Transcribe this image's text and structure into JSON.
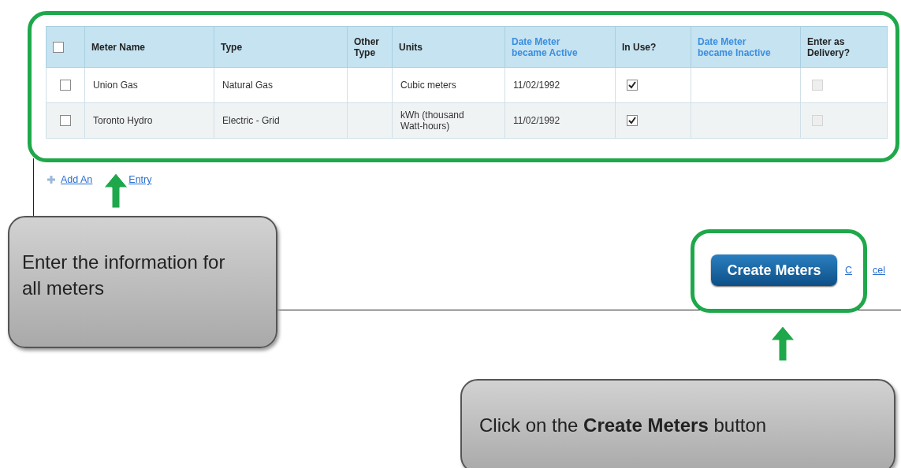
{
  "table": {
    "select_all": {
      "checked": false
    },
    "columns": [
      {
        "label": "Meter Name",
        "sortable": false
      },
      {
        "label": "Type",
        "sortable": false
      },
      {
        "label": "Other Type",
        "sortable": false
      },
      {
        "label": "Units",
        "sortable": false
      },
      {
        "label": "Date Meter became Active",
        "sortable": true
      },
      {
        "label": "In Use?",
        "sortable": false
      },
      {
        "label": "Date Meter became Inactive",
        "sortable": true
      },
      {
        "label": "Enter as Delivery?",
        "sortable": false
      }
    ],
    "rows": [
      {
        "checked": false,
        "meter_name": "Union Gas",
        "type": "Natural Gas",
        "units": "Cubic meters",
        "date_active": "11/02/1992",
        "in_use": {
          "checked": true
        },
        "delivery": {
          "checked": false,
          "disabled": true
        }
      },
      {
        "checked": false,
        "meter_name": "Toronto Hydro",
        "type": "Electric - Grid",
        "units": "kWh (thousand Watt-hours)",
        "date_active": "11/02/1992",
        "in_use": {
          "checked": true
        },
        "delivery": {
          "checked": false,
          "disabled": true
        }
      }
    ]
  },
  "add_link": {
    "parts": [
      "Add An",
      "Entry"
    ]
  },
  "create_button": "Create Meters",
  "cancel_link": {
    "parts": [
      "C",
      "cel"
    ]
  },
  "callouts": [
    {
      "text": "Enter the information for all meters"
    },
    {
      "text": "Click on the **Create Meters** button"
    }
  ]
}
